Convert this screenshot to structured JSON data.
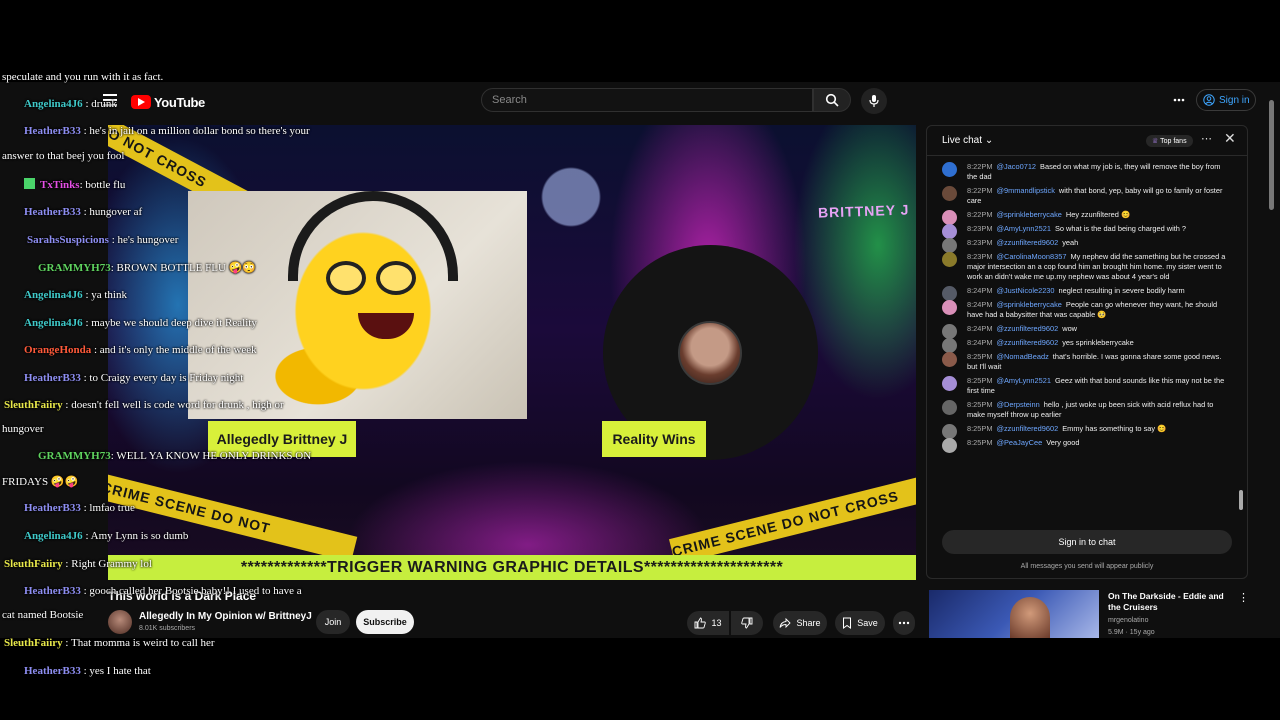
{
  "header": {
    "logo_text": "YouTube",
    "search_placeholder": "Search",
    "signin_label": "Sign in"
  },
  "player": {
    "tape_left": "DO NOT CROSS",
    "tape_bottom_left": "CRIME SCENE DO NOT",
    "tape_bottom_right": "CRIME SCENE DO NOT CROSS",
    "brand_text": "BRITTNEY J",
    "label_left": "Allegedly Brittney J",
    "label_right": "Reality Wins",
    "trigger_banner": "*************TRIGGER WARNING GRAPHIC DETAILS*********************"
  },
  "video": {
    "title": "This world is a Dark Place",
    "channel_name": "Allegedly In My Opinion w/ BrittneyJ",
    "subscribers": "8.01K subscribers",
    "join_label": "Join",
    "subscribe_label": "Subscribe",
    "likes": "13",
    "share_label": "Share",
    "save_label": "Save"
  },
  "live_chat": {
    "title": "Live chat",
    "filter": "Top fans",
    "input_label": "Sign in to chat",
    "note": "All messages you send will appear publicly",
    "messages": [
      {
        "time": "8:22PM",
        "user": "@Jaco0712",
        "text": "Based on what my job is, they will remove the boy from the dad",
        "avatar_color": "#2f6fd1"
      },
      {
        "time": "8:22PM",
        "user": "@9mmandlipstick",
        "text": "with that bond, yep, baby will go to family or foster care",
        "avatar_color": "#6a4a3a"
      },
      {
        "time": "8:22PM",
        "user": "@sprinkleberrycake",
        "text": "Hey zzunfiltered 😊",
        "avatar_color": "#d98fb8"
      },
      {
        "time": "8:23PM",
        "user": "@AmyLynn2521",
        "text": "So what is the dad being charged with ?",
        "avatar_color": "#a58ed6"
      },
      {
        "time": "8:23PM",
        "user": "@zzunfiltered9602",
        "text": "yeah",
        "avatar_color": "#777777"
      },
      {
        "time": "8:23PM",
        "user": "@CarolinaMoon8357",
        "text": "My nephew did the samething but he crossed a major intersection an a cop found him an brought him home. my sister went to work an didn't wake me up.my nephew was about 4 year's old",
        "avatar_color": "#8a7a2a"
      },
      {
        "time": "8:24PM",
        "user": "@JustNicole2230",
        "text": "neglect resulting in severe bodily harm",
        "avatar_color": "#555a66"
      },
      {
        "time": "8:24PM",
        "user": "@sprinkleberrycake",
        "text": "People can go whenever they want, he should have had a babysitter that was capable 🥺",
        "avatar_color": "#d98fb8"
      },
      {
        "time": "8:24PM",
        "user": "@zzunfiltered9602",
        "text": "wow",
        "avatar_color": "#777777"
      },
      {
        "time": "8:24PM",
        "user": "@zzunfiltered9602",
        "text": "yes sprinkleberrycake",
        "avatar_color": "#777777"
      },
      {
        "time": "8:25PM",
        "user": "@NomadBeadz",
        "text": "that's horrible. I was gonna share some good news. but I'll wait",
        "avatar_color": "#8a5a4a"
      },
      {
        "time": "8:25PM",
        "user": "@AmyLynn2521",
        "text": "Geez with that bond sounds like this may not be the first time",
        "avatar_color": "#a58ed6"
      },
      {
        "time": "8:25PM",
        "user": "@Derpsteinn",
        "text": "hello , just woke up been sick with acid reflux had to make myself throw up earlier",
        "avatar_color": "#666666"
      },
      {
        "time": "8:25PM",
        "user": "@zzunfiltered9602",
        "text": "Emmy has something to say 😊",
        "avatar_color": "#777777"
      },
      {
        "time": "8:25PM",
        "user": "@PeaJayCee",
        "text": "Very good",
        "avatar_color": "#aaaaaa"
      }
    ]
  },
  "recommendation": {
    "title": "On The Darkside - Eddie and the Cruisers",
    "channel": "mrgenolatino",
    "meta": "5.9M · 15y ago"
  },
  "overlay_chat": [
    {
      "user": "",
      "text": "speculate and you run with it as fact.",
      "color": "#ffffff"
    },
    {
      "user": "Angelina4J6",
      "text": " : drunk",
      "color": "#3fc9c9"
    },
    {
      "user": "HeatherB33",
      "text": " : he's in jail on a million dollar bond so there's your",
      "color": "#8e8ef2"
    },
    {
      "user": "",
      "text": "answer to that beej you fool",
      "color": "#ffffff"
    },
    {
      "user": "TxTinks",
      "text": ": bottle flu",
      "color": "#e64fe6"
    },
    {
      "user": "HeatherB33",
      "text": " : hungover af",
      "color": "#8e8ef2"
    },
    {
      "user": "SarahsSuspicions",
      "text": " : he's hungover",
      "color": "#8e8ef2"
    },
    {
      "user": "GRAMMYH73",
      "text": ": BROWN BOTTLE FLU 🤪😳",
      "color": "#5fd35f"
    },
    {
      "user": "Angelina4J6",
      "text": " : ya think",
      "color": "#3fc9c9"
    },
    {
      "user": "Angelina4J6",
      "text": " : maybe we should deep dive it Reality",
      "color": "#3fc9c9"
    },
    {
      "user": "OrangeHonda",
      "text": " : and it's only the middle of the week",
      "color": "#ff5a3a"
    },
    {
      "user": "HeatherB33",
      "text": " : to Craigy every day is Friday night",
      "color": "#8e8ef2"
    },
    {
      "user": "SleuthFaiiry",
      "text": " : doesn't fell well is code word for drunk , high or",
      "color": "#e8e84a"
    },
    {
      "user": "",
      "text": "hungover",
      "color": "#ffffff"
    },
    {
      "user": "GRAMMYH73",
      "text": ": WELL YA KNOW HE ONLY DRINKS ON",
      "color": "#5fd35f"
    },
    {
      "user": "",
      "text": "FRIDAYS 🤪🤪",
      "color": "#ffffff"
    },
    {
      "user": "HeatherB33",
      "text": " : lmfao true",
      "color": "#8e8ef2"
    },
    {
      "user": "Angelina4J6",
      "text": " : Amy Lynn is so dumb",
      "color": "#3fc9c9"
    },
    {
      "user": "SleuthFaiiry",
      "text": " : Right Grammy lol",
      "color": "#e8e84a"
    },
    {
      "user": "HeatherB33",
      "text": " : gooch called her Bootsie baby!! I used to have a",
      "color": "#8e8ef2"
    },
    {
      "user": "",
      "text": "cat named Bootsie",
      "color": "#ffffff"
    },
    {
      "user": "SleuthFaiiry",
      "text": " : That momma is weird to call her",
      "color": "#e8e84a"
    },
    {
      "user": "HeatherB33",
      "text": " : yes I hate that",
      "color": "#8e8ef2"
    }
  ]
}
